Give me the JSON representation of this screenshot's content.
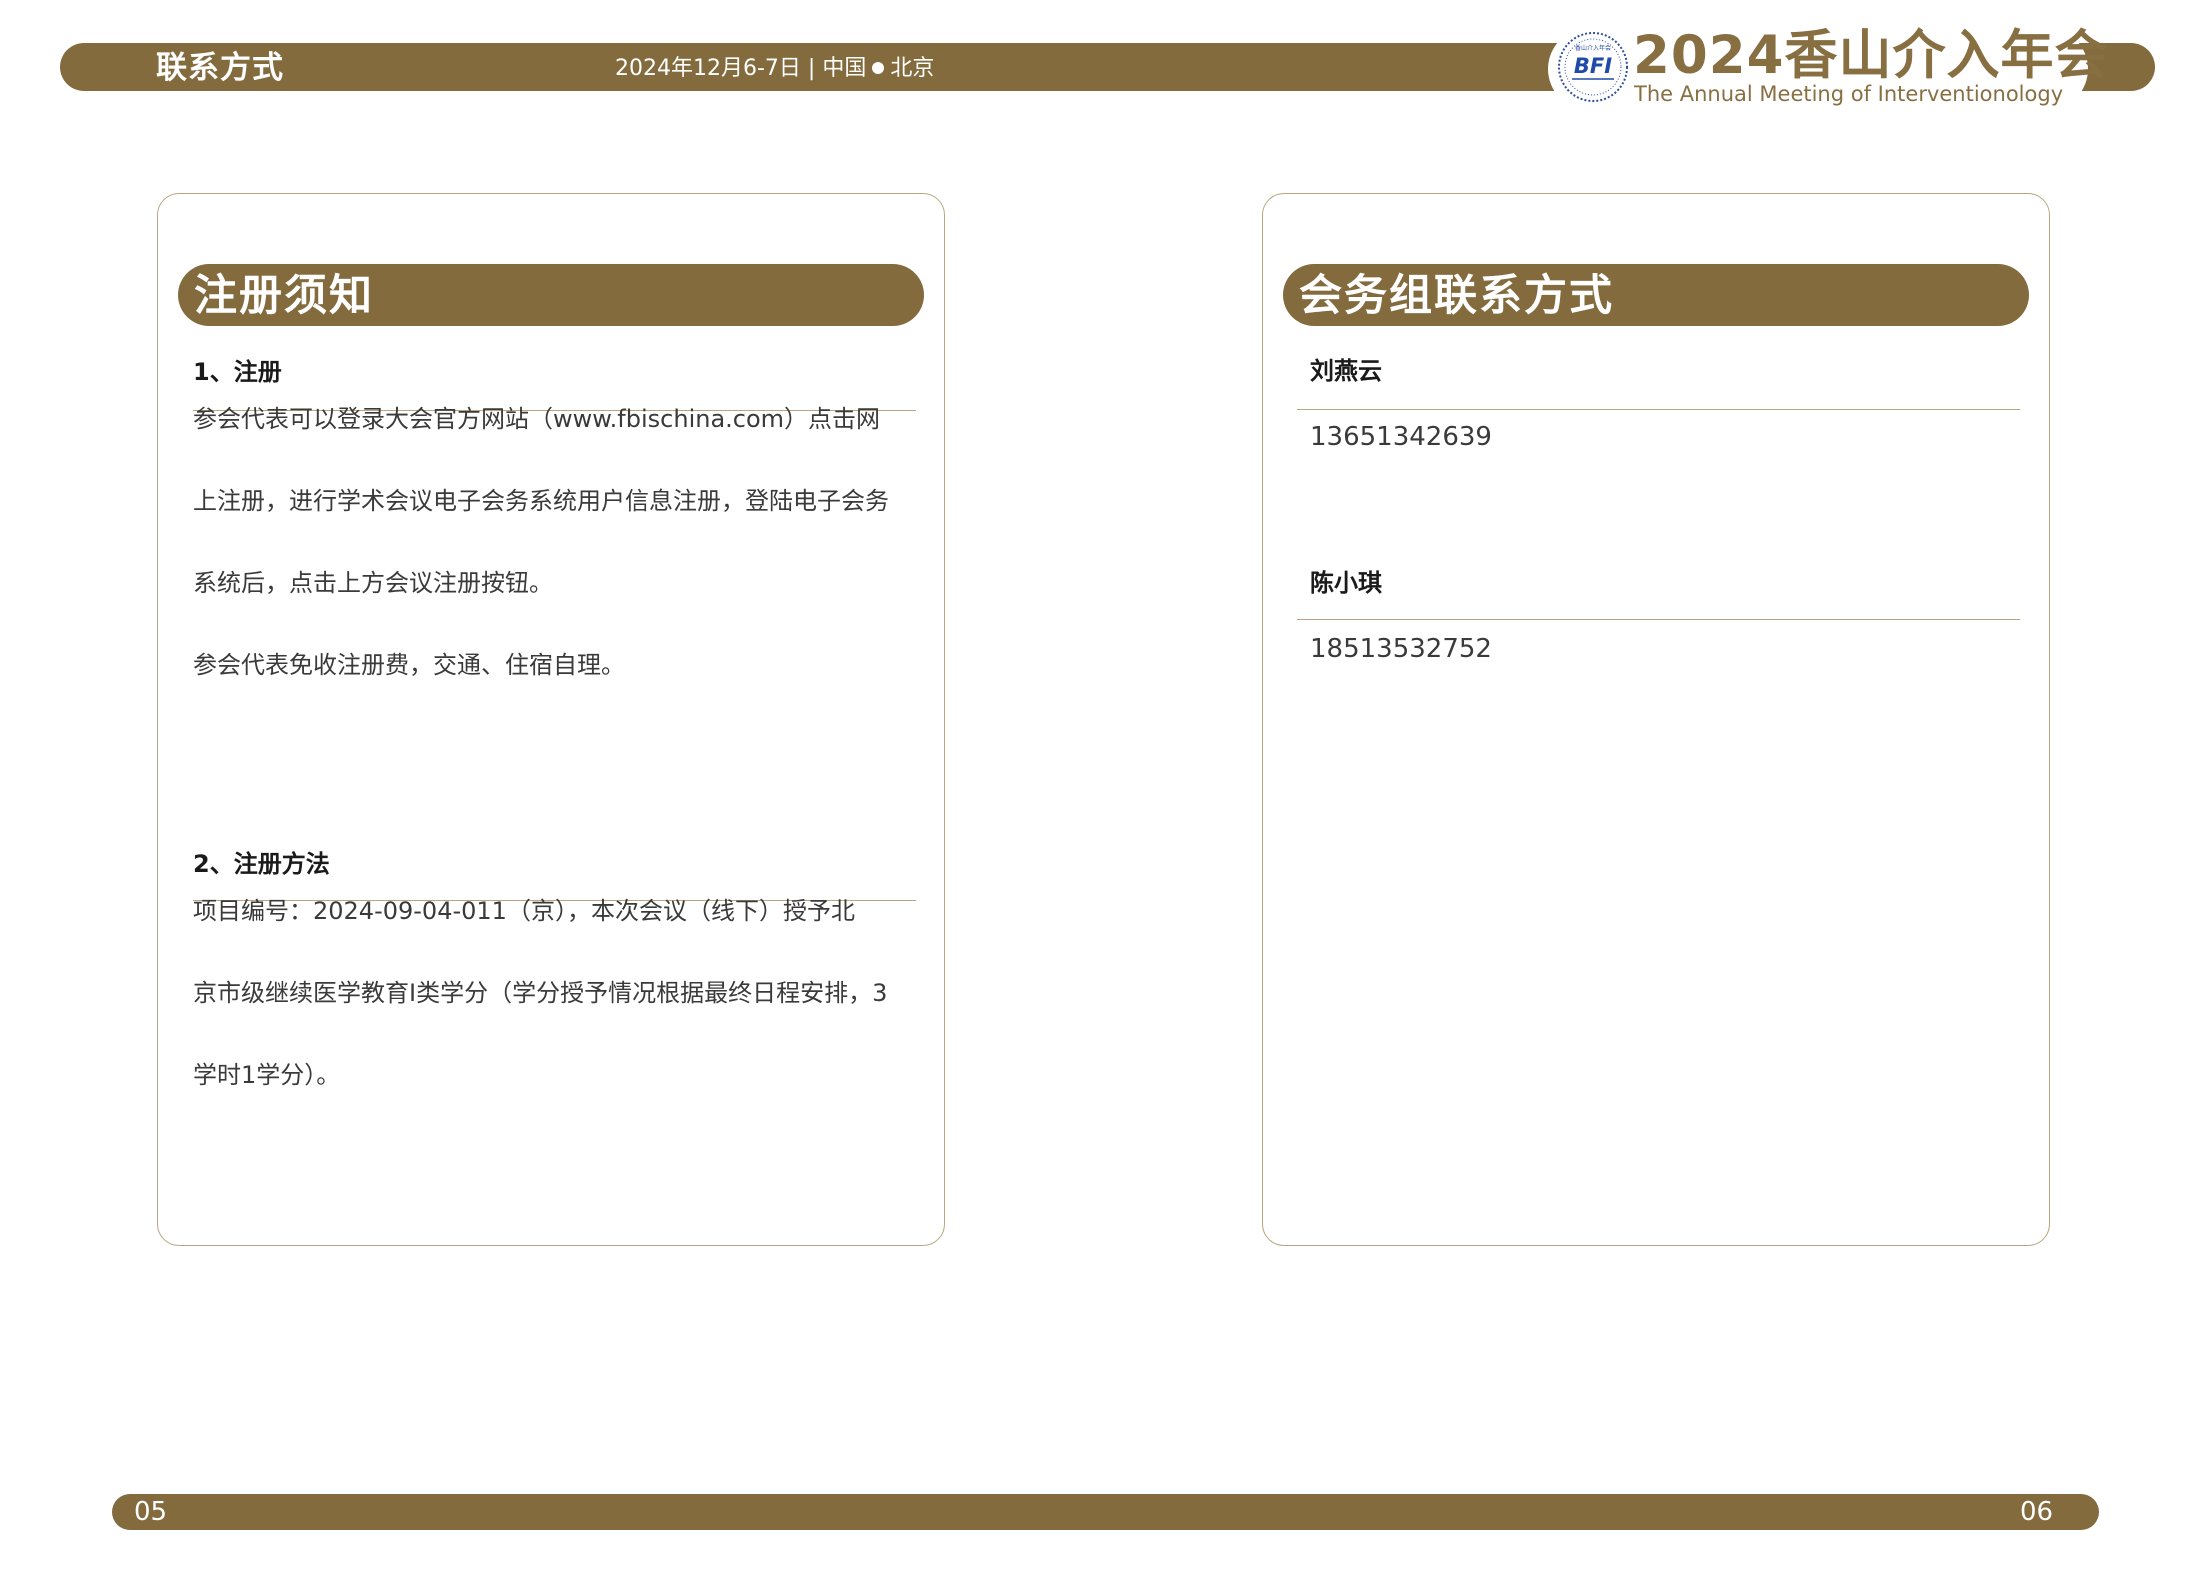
{
  "header": {
    "section_title": "联系方式",
    "date": "2024年12月6-7日",
    "separator": "|",
    "country": "中国",
    "city": "北京",
    "brand_cn": "2024香山介入年会",
    "brand_en": "The Annual Meeting of Interventionology",
    "logo_text": "BFI",
    "logo_top_text": "香山介入年会"
  },
  "registration": {
    "title": "注册须知",
    "section1": {
      "heading": "1、注册",
      "lines": [
        "参会代表可以登录大会官方网站（www.fbischina.com）点击网",
        "上注册，进行学术会议电子会务系统用户信息注册，登陆电子会务",
        "系统后，点击上方会议注册按钮。",
        "参会代表免收注册费，交通、住宿自理。"
      ]
    },
    "section2": {
      "heading": "2、注册方法",
      "lines": [
        "项目编号：2024-09-04-011（京），本次会议（线下）授予北",
        "京市级继续医学教育I类学分（学分授予情况根据最终日程安排，3",
        "学时1学分）。"
      ]
    }
  },
  "contacts": {
    "title": "会务组联系方式",
    "people": [
      {
        "name": "刘燕云",
        "phone": "13651342639"
      },
      {
        "name": "陈小琪",
        "phone": "18513532752"
      }
    ]
  },
  "footer": {
    "left_page": "05",
    "right_page": "06"
  }
}
